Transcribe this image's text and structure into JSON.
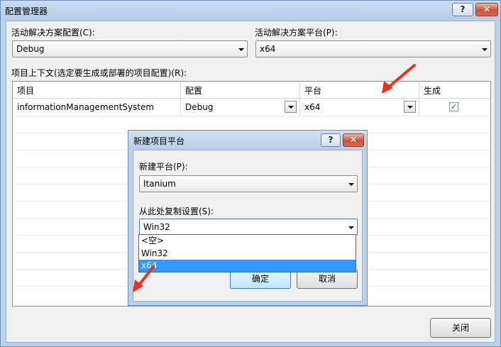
{
  "main_window": {
    "title": "配置管理器",
    "help_btn": "?",
    "close_btn": "✕",
    "active_config_label": "活动解决方案配置(C):",
    "active_config_value": "Debug",
    "active_platform_label": "活动解决方案平台(P):",
    "active_platform_value": "x64",
    "grid_label": "项目上下文(选定要生成或部署的项目配置)(R):",
    "columns": [
      "项目",
      "配置",
      "平台",
      "生成"
    ],
    "row": {
      "project": "informationManagementSystem",
      "config": "Debug",
      "platform": "x64",
      "build_checked": true
    },
    "close_button": "关闭"
  },
  "dialog": {
    "title": "新建项目平台",
    "help_btn": "?",
    "close_btn": "✕",
    "new_platform_label": "新建平台(P):",
    "new_platform_value": "Itanium",
    "copy_from_label": "从此处复制设置(S):",
    "copy_from_value": "Win32",
    "copy_options": [
      "<空>",
      "Win32",
      "x64"
    ],
    "selected_option_index": 2,
    "ok_button": "确定",
    "cancel_button": "取消"
  },
  "colors": {
    "annotation_arrow": "#e8331c",
    "selection": "#3399ff"
  }
}
